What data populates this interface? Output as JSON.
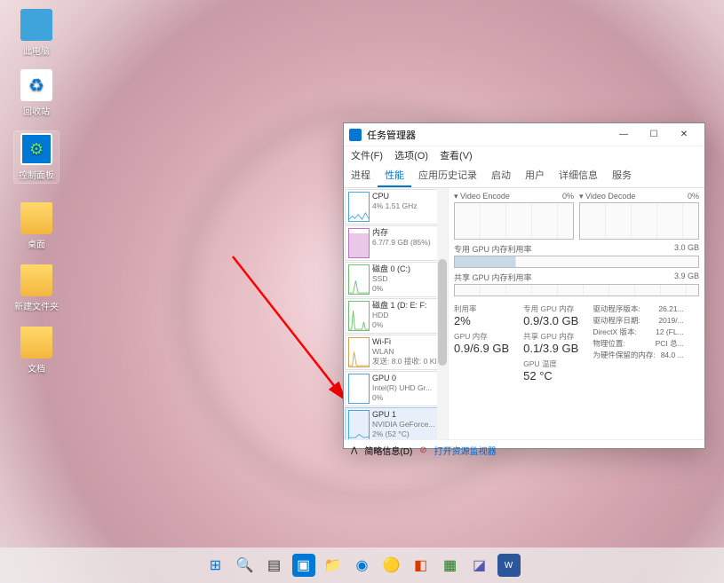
{
  "desktop": {
    "icons": [
      "此电脑",
      "回收站",
      "控制面板",
      "桌面",
      "新建文件夹",
      "文档"
    ]
  },
  "window": {
    "title": "任务管理器",
    "menu": [
      "文件(F)",
      "选项(O)",
      "查看(V)"
    ],
    "tabs": [
      "进程",
      "性能",
      "应用历史记录",
      "启动",
      "用户",
      "详细信息",
      "服务"
    ],
    "active_tab": 1
  },
  "sidebar": {
    "items": [
      {
        "title": "CPU",
        "sub1": "4% 1.51 GHz",
        "color": "#4aa8d8"
      },
      {
        "title": "内存",
        "sub1": "6.7/7.9 GB (85%)",
        "color": "#c46fc0"
      },
      {
        "title": "磁盘 0 (C:)",
        "sub1": "SSD",
        "sub2": "0%",
        "color": "#6ec06e"
      },
      {
        "title": "磁盘 1 (D: E: F:",
        "sub1": "HDD",
        "sub2": "0%",
        "color": "#6ec06e"
      },
      {
        "title": "Wi-Fi",
        "sub1": "WLAN",
        "sub2": "发送: 8.0 接收: 0 Kl",
        "color": "#d8a050"
      },
      {
        "title": "GPU 0",
        "sub1": "Intel(R) UHD Gr...",
        "sub2": "0%",
        "color": "#4aa8d8"
      },
      {
        "title": "GPU 1",
        "sub1": "NVIDIA GeForce...",
        "sub2": "2% (52 °C)",
        "color": "#4aa8d8"
      }
    ],
    "selected": 6
  },
  "charts": {
    "encode": {
      "label": "Video Encode",
      "pct": "0%"
    },
    "decode": {
      "label": "Video Decode",
      "pct": "0%"
    },
    "dedmem": {
      "label": "专用 GPU 内存利用率",
      "max": "3.0 GB"
    },
    "shrmem": {
      "label": "共享 GPU 内存利用率",
      "max": "3.9 GB"
    }
  },
  "stats": {
    "util": {
      "label": "利用率",
      "value": "2%"
    },
    "gpumem": {
      "label": "GPU 内存",
      "value": "0.9/6.9 GB"
    },
    "dedmem": {
      "label": "专用 GPU 内存",
      "value": "0.9/3.0 GB"
    },
    "shrmem": {
      "label": "共享 GPU 内存",
      "value": "0.1/3.9 GB"
    },
    "temp": {
      "label": "GPU 温度",
      "value": "52 °C"
    }
  },
  "info": {
    "driver_ver": {
      "label": "驱动程序版本:",
      "value": "26.21..."
    },
    "driver_date": {
      "label": "驱动程序日期:",
      "value": "2019/..."
    },
    "directx": {
      "label": "DirectX 版本:",
      "value": "12 (FL..."
    },
    "phys": {
      "label": "物理位置:",
      "value": "PCI 总..."
    },
    "reserved": {
      "label": "为硬件保留的内存:",
      "value": "84.0 ..."
    }
  },
  "footer": {
    "brief": "简略信息(D)",
    "resmon": "打开资源监视器"
  }
}
